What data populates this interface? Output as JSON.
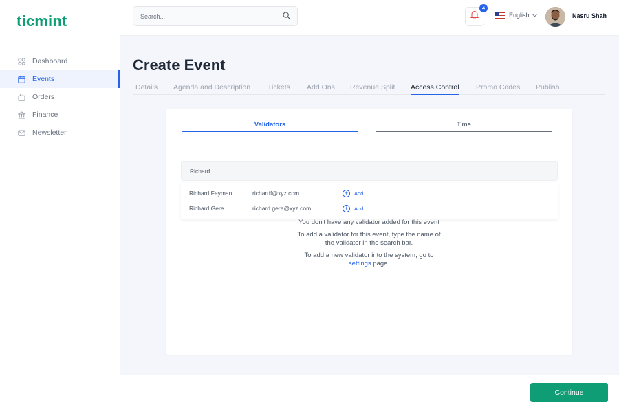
{
  "brand": {
    "logo": "ticmint",
    "color": "#0f9d76"
  },
  "sidebar": {
    "items": [
      {
        "label": "Dashboard",
        "icon": "grid-icon",
        "active": false
      },
      {
        "label": "Events",
        "icon": "calendar-icon",
        "active": true
      },
      {
        "label": "Orders",
        "icon": "bag-icon",
        "active": false
      },
      {
        "label": "Finance",
        "icon": "bank-icon",
        "active": false
      },
      {
        "label": "Newsletter",
        "icon": "mail-icon",
        "active": false
      }
    ]
  },
  "header": {
    "search_placeholder": "Search...",
    "notifications": "4",
    "language": "English",
    "username": "Nasru Shah"
  },
  "page": {
    "title": "Create Event",
    "tabs": [
      "Details",
      "Agenda and Description",
      "Tickets",
      "Add Ons",
      "Revenue Split",
      "Access Control",
      "Promo Codes",
      "Publish"
    ],
    "active_tab": "Access Control"
  },
  "access": {
    "subtabs": [
      "Validators",
      "Time"
    ],
    "search_value": "Richard",
    "results": [
      {
        "name": "Richard Feyman",
        "email": "richardf@xyz.com",
        "action": "Add"
      },
      {
        "name": "Richard Gere",
        "email": "richard.gere@xyz.com",
        "action": "Add"
      }
    ],
    "empty": {
      "line1": "You don't have any validator added for this event",
      "line2a": "To add a validator for this event, type the name of",
      "line2b": "the validator in the search bar.",
      "line3a": "To add a new validator into the system, go to",
      "link": "settings",
      "line3b": " page."
    }
  },
  "footer": {
    "continue_label": "Continue"
  },
  "colors": {
    "accent": "#2563eb",
    "primary_button": "#0f9d76"
  }
}
